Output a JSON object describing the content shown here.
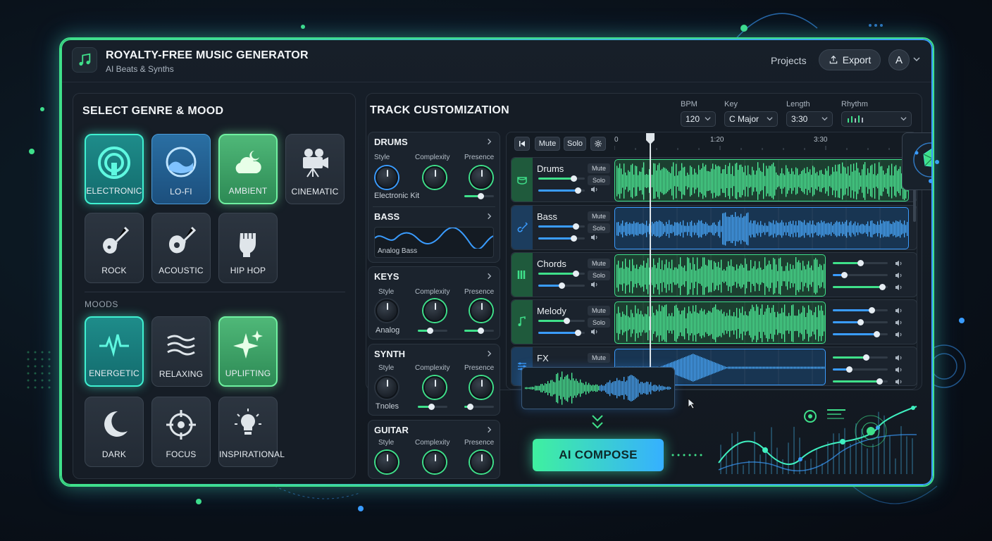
{
  "app": {
    "title": "ROYALTY-FREE MUSIC GENERATOR",
    "subtitle": "AI Beats & Synths",
    "logo_icon": "music-note-icon"
  },
  "header": {
    "projects_label": "Projects",
    "export_label": "Export",
    "avatar_initial": "A"
  },
  "genre_panel": {
    "title": "SELECT GENRE & MOOD",
    "genres": [
      {
        "label": "ELECTRONIC",
        "icon": "target-icon",
        "state": "selected-teal"
      },
      {
        "label": "LO-FI",
        "icon": "wave-circle-icon",
        "state": "selected-blue"
      },
      {
        "label": "AMBIENT",
        "icon": "cloud-moon-icon",
        "state": "selected-green"
      },
      {
        "label": "CINEMATIC",
        "icon": "film-camera-icon",
        "state": "normal"
      },
      {
        "label": "ROCK",
        "icon": "electric-guitar-icon",
        "state": "normal"
      },
      {
        "label": "ACOUSTIC",
        "icon": "acoustic-guitar-icon",
        "state": "normal"
      },
      {
        "label": "HIP HOP",
        "icon": "fist-icon",
        "state": "normal"
      }
    ],
    "moods_label": "MOODS",
    "moods": [
      {
        "label": "ENERGETIC",
        "icon": "pulse-icon",
        "state": "selected-teal"
      },
      {
        "label": "RELAXING",
        "icon": "waves-icon",
        "state": "normal"
      },
      {
        "label": "UPLIFTING",
        "icon": "sparkles-icon",
        "state": "selected-green"
      },
      {
        "label": "DARK",
        "icon": "moon-icon",
        "state": "normal"
      },
      {
        "label": "FOCUS",
        "icon": "crosshair-icon",
        "state": "normal"
      },
      {
        "label": "INSPIRATIONAL",
        "icon": "lightbulb-icon",
        "state": "normal"
      }
    ]
  },
  "customization": {
    "title": "TRACK CUSTOMIZATION",
    "bpm": {
      "label": "BPM",
      "value": "120"
    },
    "key": {
      "label": "Key",
      "value": "C Major"
    },
    "length": {
      "label": "Length",
      "value": "3:30"
    },
    "rhythm": {
      "label": "Rhythm"
    }
  },
  "instruments": {
    "drums": {
      "name": "DRUMS",
      "style_label": "Style",
      "complexity_label": "Complexity",
      "presence_label": "Presence",
      "style_value": "Electronic Kit",
      "presence": 0.55
    },
    "bass": {
      "name": "BASS",
      "style_value": "Analog Bass"
    },
    "keys": {
      "name": "KEYS",
      "style_label": "Style",
      "complexity_label": "Complexity",
      "presence_label": "Presence",
      "style_value": "Analog",
      "complexity": 0.4,
      "presence": 0.55
    },
    "synth": {
      "name": "SYNTH",
      "style_label": "Style",
      "complexity_label": "Complexity",
      "presence_label": "Presence",
      "style_value": "Tnoles",
      "complexity": 0.45,
      "presence": 0.2
    },
    "guitar": {
      "name": "GUITAR",
      "style_label": "Style",
      "complexity_label": "Complexity",
      "presence_label": "Presence"
    }
  },
  "timeline": {
    "mute_label": "Mute",
    "solo_label": "Solo",
    "ruler": [
      "0",
      "1:20",
      "3:30"
    ],
    "tracks": [
      {
        "name": "Drums",
        "mute": "Mute",
        "solo": "Solo",
        "vol": 0.75,
        "pan": 0.85,
        "color": "#3fe08a"
      },
      {
        "name": "Bass",
        "mute": "Mute",
        "solo": "Solo",
        "vol": 0.8,
        "pan": 0.75,
        "color": "#3a9cff"
      },
      {
        "name": "Chords",
        "mute": "Mute",
        "solo": "Solo",
        "vol": 0.8,
        "pan": 0.5,
        "color": "#3fe08a"
      },
      {
        "name": "Melody",
        "mute": "Mute",
        "solo": "Solo",
        "vol": 0.6,
        "pan": 0.85,
        "color": "#3fe08a"
      },
      {
        "name": "FX",
        "mute": "Mute",
        "color": "#3a9cff"
      }
    ]
  },
  "compose": {
    "label": "AI COMPOSE"
  },
  "colors": {
    "accent_green": "#3fe08a",
    "accent_blue": "#3a9cff",
    "accent_teal": "#3ff0d0"
  }
}
